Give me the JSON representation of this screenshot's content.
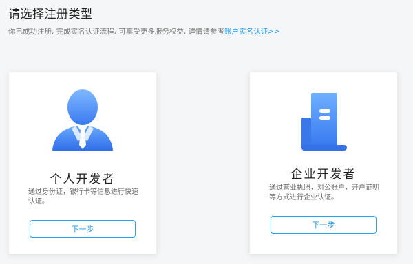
{
  "header": {
    "title": "请选择注册类型",
    "subtitle_lead": "你已成功注册, 完成实名认证流程, 可享受更多服务权益, 详情请参考",
    "subtitle_link": "账户实名认证>>"
  },
  "cards": [
    {
      "title": "个人开发者",
      "description": "通过身份证，银行卡等信息进行快速认证。",
      "button_label": "下一步",
      "icon": "person-icon"
    },
    {
      "title": "企业开发者",
      "description": "通过营业执照，对公账户，开户证明等方式进行企业认证。",
      "button_label": "下一步",
      "icon": "building-icon"
    }
  ],
  "colors": {
    "accent": "#1e9bf0",
    "icon_gradient_start": "#74b3ff",
    "icon_gradient_end": "#3d7cf2"
  }
}
